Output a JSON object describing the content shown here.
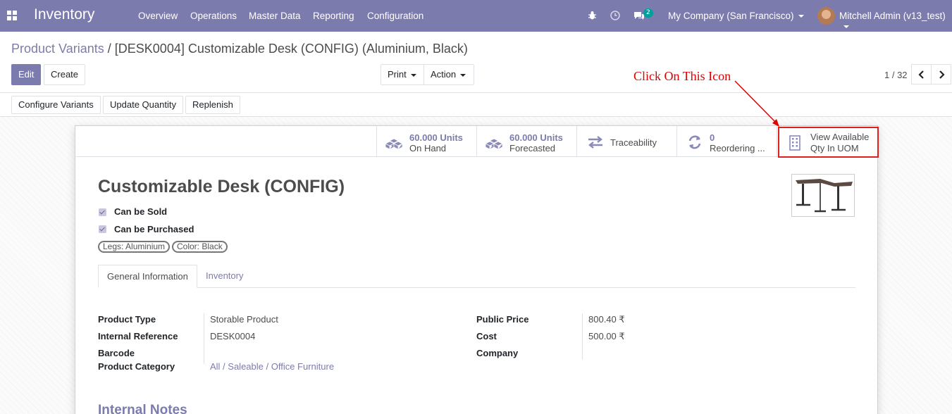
{
  "navbar": {
    "app_title": "Inventory",
    "menu": [
      "Overview",
      "Operations",
      "Master Data",
      "Reporting",
      "Configuration"
    ],
    "chat_count": "2",
    "company": "My Company (San Francisco)",
    "user": "Mitchell Admin (v13_test)",
    "color": "#7c7bad"
  },
  "breadcrumb": {
    "parent": "Product Variants",
    "separator": "/",
    "current": "[DESK0004] Customizable Desk (CONFIG) (Aluminium, Black)"
  },
  "actions": {
    "edit": "Edit",
    "create": "Create",
    "print": "Print",
    "action": "Action"
  },
  "pager": {
    "value": "1 / 32"
  },
  "statusbar": {
    "configure_variants": "Configure Variants",
    "update_quantity": "Update Quantity",
    "replenish": "Replenish"
  },
  "stat_buttons": {
    "on_hand_value": "60.000 Units",
    "on_hand_label": "On Hand",
    "forecasted_value": "60.000 Units",
    "forecasted_label": "Forecasted",
    "traceability": "Traceability",
    "reordering_value": "0",
    "reordering_label": "Reordering ...",
    "uom_line1": "View Available",
    "uom_line2": "Qty In UOM"
  },
  "annotation": "Click On This Icon",
  "product": {
    "name": "Customizable Desk (CONFIG)",
    "can_be_sold": "Can be Sold",
    "can_be_purchased": "Can be Purchased",
    "tags": [
      "Legs: Aluminium",
      "Color: Black"
    ]
  },
  "tabs": [
    "General Information",
    "Inventory"
  ],
  "fields_left": {
    "product_type_label": "Product Type",
    "product_type": "Storable Product",
    "internal_reference_label": "Internal Reference",
    "internal_reference": "DESK0004",
    "barcode_label": "Barcode",
    "product_category_label": "Product Category",
    "product_category": "All / Saleable / Office Furniture"
  },
  "fields_right": {
    "public_price_label": "Public Price",
    "public_price": "800.40 ₹",
    "cost_label": "Cost",
    "cost": "500.00 ₹",
    "company_label": "Company"
  },
  "internal_notes": "Internal Notes"
}
